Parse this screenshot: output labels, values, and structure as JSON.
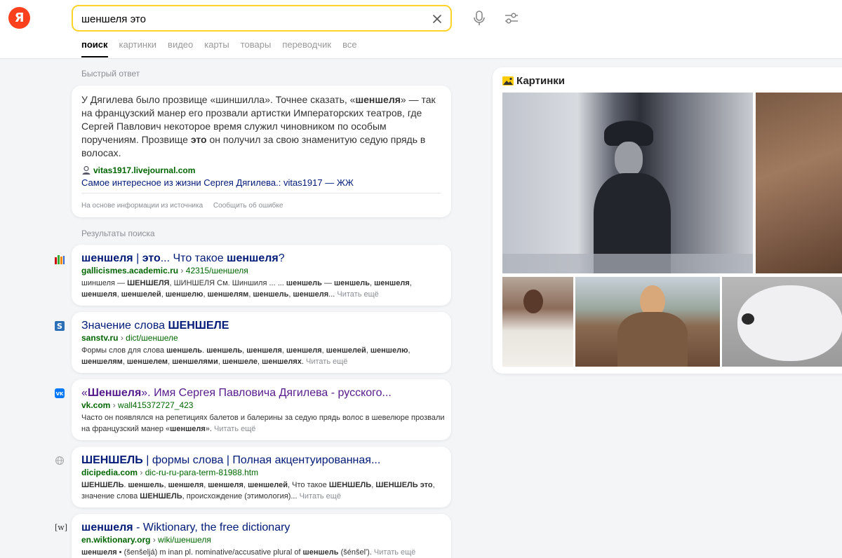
{
  "logo": {
    "letter": "Я"
  },
  "search": {
    "query": "шеншеля это"
  },
  "tabs": [
    {
      "label": "поиск"
    },
    {
      "label": "картинки"
    },
    {
      "label": "видео"
    },
    {
      "label": "карты"
    },
    {
      "label": "товары"
    },
    {
      "label": "переводчик"
    },
    {
      "label": "все"
    }
  ],
  "quick_answer": {
    "section_label": "Быстрый ответ",
    "text_html": "У Дягилева было прозвище «шиншилла». Точнее сказать, «<b>шеншеля</b>» — так на французский манер его прозвали артистки Императорских театров, где Сергей Павлович некоторое время служил чиновником по особым поручениям. Прозвище <b>это</b> он получил за свою знаменитую седую прядь в волосах.",
    "source": "vitas1917.livejournal.com",
    "link": "Самое интересное из жизни Сергея Дягилева.: vitas1917 — ЖЖ",
    "based_on": "На основе информации из источника",
    "report": "Сообщить об ошибке"
  },
  "results_label": "Результаты поиска",
  "results": [
    {
      "title_html": "<b>шеншеля</b> | <b>это</b>... Что такое <b>шеншеля</b>?",
      "domain": "gallicismes.academic.ru",
      "path": "42315/шеншеля",
      "snippet_html": "шиншеля — <b>ШЕНШЕЛЯ</b>, ШИНШЕЛЯ См. Шиншиля ... ... <b>шеншель</b> — <b>шеншель</b>, <b>шеншеля</b>, <b>шеншеля</b>, <b>шеншелей</b>, <b>шеншелю</b>, <b>шеншелям</b>, <b>шеншель</b>, <b>шеншеля</b>...",
      "more": "Читать ещё"
    },
    {
      "title_html": "Значение слова <b>ШЕНШЕЛЕ</b>",
      "domain": "sanstv.ru",
      "path": "dict/шеншеле",
      "snippet_html": "Формы слов для слова <b>шеншель</b>. <b>шеншель</b>, <b>шеншеля</b>, <b>шеншеля</b>, <b>шеншелей</b>, <b>шеншелю</b>, <b>шеншелям</b>, <b>шеншелем</b>, <b>шеншелями</b>, <b>шеншеле</b>, <b>шеншелях</b>.",
      "more": "Читать ещё"
    },
    {
      "title_html": "«<b>Шеншеля</b>». Имя Сергея Павловича Дягилева - русского...",
      "domain": "vk.com",
      "path": "wall415372727_423",
      "snippet_html": "Часто он появлялся на репетициях балетов и балерины за седую прядь волос в шевелюре прозвали на французский манер «<b>шеншеля</b>».",
      "more": "Читать ещё"
    },
    {
      "title_html": "<b>ШЕНШЕЛЬ</b> | формы слова | Полная акцентуированная...",
      "domain": "dicipedia.com",
      "path": "dic-ru-ru-para-term-81988.htm",
      "snippet_html": "<b>ШЕНШЕЛЬ</b>. <b>шеншель</b>, <b>шеншеля</b>, <b>шеншеля</b>, <b>шеншелей</b>, Что такое <b>ШЕНШЕЛЬ</b>, <b>ШЕНШЕЛЬ это</b>, значение слова <b>ШЕНШЕЛЬ</b>, происхождение (этимология)...",
      "more": "Читать ещё"
    },
    {
      "title_html": "<b>шеншеля</b> - Wiktionary, the free dictionary",
      "domain": "en.wiktionary.org",
      "path": "wiki/шеншеля",
      "snippet_html": "<b>шеншеля</b> • (šenšeljá) m inan pl. nominative/accusative plural of <b>шеншель</b> (šénšelʹ).",
      "more": "Читать ещё",
      "favicon_text": "[w]"
    }
  ],
  "images_panel": {
    "title": "Картинки"
  },
  "colors": {
    "accent": "#fed42b",
    "brand": "#fc3f1d",
    "link": "#001a77",
    "url": "#006600",
    "visited": "#551a8b"
  }
}
